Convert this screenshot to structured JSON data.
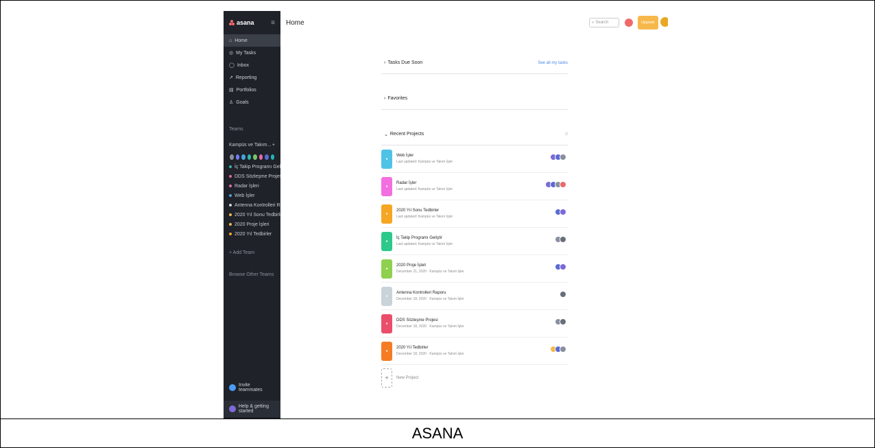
{
  "caption": "ASANA",
  "sidebar": {
    "logo": "asana",
    "collapse_icon": "hamburger-icon",
    "nav": [
      {
        "label": "Home",
        "icon": "home-icon",
        "active": true
      },
      {
        "label": "My Tasks",
        "icon": "check-icon"
      },
      {
        "label": "Inbox",
        "icon": "bell-icon"
      },
      {
        "label": "Reporting",
        "icon": "chart-icon"
      },
      {
        "label": "Portfolios",
        "icon": "folder-icon"
      },
      {
        "label": "Goals",
        "icon": "person-icon"
      }
    ],
    "teams_header": "Teams",
    "team_name": "Kampüs ve Takım...",
    "team_add": "+",
    "avatar_colors": [
      "#8a8fa0",
      "#6f7cf5",
      "#4aa3df",
      "#2fb7a8",
      "#7bc46a",
      "#e86aa5",
      "#5a6bd0",
      "#22b4b0"
    ],
    "projects": [
      {
        "label": "İç Takip Programı Geliştir",
        "color": "#2fb7a8"
      },
      {
        "label": "DDS Sözleşme Projesi",
        "color": "#e86a8b"
      },
      {
        "label": "Radar İşleri",
        "color": "#e86aa5"
      },
      {
        "label": "Web İşler",
        "color": "#4aa3df"
      },
      {
        "label": "Antenna Kontrolleri Ray...",
        "color": "#d3d5da"
      },
      {
        "label": "2020 Yıl Sonu Tedbirler",
        "color": "#f7b84b"
      },
      {
        "label": "2020 Proje İşleri",
        "color": "#f7b84b"
      },
      {
        "label": "2020 Yıl Tedbirler",
        "color": "#f5a623"
      }
    ],
    "add_team": "+ Add Team",
    "browse": "Browse Other Teams",
    "invite": "Invite teammates",
    "help": "Help & getting started"
  },
  "topbar": {
    "title": "Home",
    "search_placeholder": "Search",
    "upgrade_label": "Upgrade"
  },
  "main": {
    "tasks_due_soon": "Tasks Due Soon",
    "see_all": "See all my tasks",
    "favorites": "Favorites",
    "recent_projects": "Recent Projects",
    "recent_projects_menu": "⁝⁝",
    "projects": [
      {
        "name": "Web İşler",
        "sub": "Last updated: Kampüs ve Takım İşler",
        "color": "#4ec3e6",
        "avatars": [
          "#7d6ad8",
          "#5a6bd0",
          "#8a8fa0"
        ]
      },
      {
        "name": "Radar İşler",
        "sub": "Last updated: Kampüs ve Takım İşler",
        "color": "#f36fe0",
        "avatars": [
          "#7d6ad8",
          "#5a6bd0",
          "#8a8fa0",
          "#e86a6a"
        ]
      },
      {
        "name": "2020 Yıl Sonu Tedbirler",
        "sub": "Last updated: Kampüs ve Takım İşler",
        "color": "#f5a623",
        "avatars": [
          "#5a6bd0",
          "#7d6ad8"
        ]
      },
      {
        "name": "İç Takip Programı Geliştir",
        "sub": "Last updated: Kampüs ve Takım İşler",
        "color": "#2dc98a",
        "avatars": [
          "#8a8fa0",
          "#6a6d7a"
        ]
      },
      {
        "name": "2020 Proje İşleri",
        "sub": "December 21, 2020 · Kampüs ve Takım İşler",
        "color": "#8fd14f",
        "avatars": [
          "#5a6bd0",
          "#7d6ad8"
        ]
      },
      {
        "name": "Antenna Kontrolleri Raporu",
        "sub": "December 18, 2020 · Kampüs ve Takım İşler",
        "color": "#c9d3da",
        "avatars": [
          "#6a6d7a"
        ]
      },
      {
        "name": "DDS Sözleşme Projesi",
        "sub": "December 18, 2020 · Kampüs ve Takım İşler",
        "color": "#ea4e6a",
        "avatars": [
          "#8a8fa0",
          "#6a6d7a"
        ]
      },
      {
        "name": "2020 Yıl Tedbirler",
        "sub": "December 18, 2020 · Kampüs ve Takım İşler",
        "color": "#f57c23",
        "avatars": [
          "#f7b84b",
          "#5a6bd0",
          "#8a8fa0"
        ]
      }
    ],
    "new_project": "New Project"
  }
}
